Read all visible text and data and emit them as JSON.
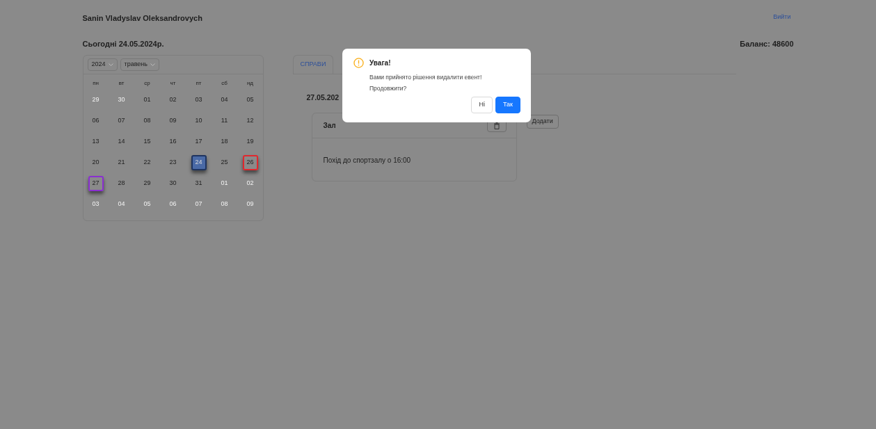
{
  "header": {
    "user_name": "Sanin Vladyslav Oleksandrovych",
    "logout": "Вийти",
    "today": "Сьогодні 24.05.2024р.",
    "balance": "Баланс: 48600"
  },
  "calendar": {
    "year": "2024",
    "month": "травень",
    "weekdays": [
      "пн",
      "вт",
      "ср",
      "чт",
      "пт",
      "сб",
      "нд"
    ],
    "weeks": [
      [
        {
          "label": "29",
          "outside": true,
          "selected": false,
          "today": false
        },
        {
          "label": "30",
          "outside": true,
          "selected": false,
          "today": false
        },
        {
          "label": "01",
          "outside": false,
          "selected": false,
          "today": false
        },
        {
          "label": "02",
          "outside": false,
          "selected": false,
          "today": false
        },
        {
          "label": "03",
          "outside": false,
          "selected": false,
          "today": false
        },
        {
          "label": "04",
          "outside": false,
          "selected": false,
          "today": false
        },
        {
          "label": "05",
          "outside": false,
          "selected": false,
          "today": false
        }
      ],
      [
        {
          "label": "06",
          "outside": false,
          "selected": false,
          "today": false
        },
        {
          "label": "07",
          "outside": false,
          "selected": false,
          "today": false
        },
        {
          "label": "08",
          "outside": false,
          "selected": false,
          "today": false
        },
        {
          "label": "09",
          "outside": false,
          "selected": false,
          "today": false
        },
        {
          "label": "10",
          "outside": false,
          "selected": false,
          "today": false
        },
        {
          "label": "11",
          "outside": false,
          "selected": false,
          "today": false
        },
        {
          "label": "12",
          "outside": false,
          "selected": false,
          "today": false
        }
      ],
      [
        {
          "label": "13",
          "outside": false,
          "selected": false,
          "today": false
        },
        {
          "label": "14",
          "outside": false,
          "selected": false,
          "today": false
        },
        {
          "label": "15",
          "outside": false,
          "selected": false,
          "today": false
        },
        {
          "label": "16",
          "outside": false,
          "selected": false,
          "today": false
        },
        {
          "label": "17",
          "outside": false,
          "selected": false,
          "today": false
        },
        {
          "label": "18",
          "outside": false,
          "selected": false,
          "today": false
        },
        {
          "label": "19",
          "outside": false,
          "selected": false,
          "today": false
        }
      ],
      [
        {
          "label": "20",
          "outside": false,
          "selected": false,
          "today": false
        },
        {
          "label": "21",
          "outside": false,
          "selected": false,
          "today": false
        },
        {
          "label": "22",
          "outside": false,
          "selected": false,
          "today": false
        },
        {
          "label": "23",
          "outside": false,
          "selected": false,
          "today": false
        },
        {
          "label": "24",
          "outside": false,
          "selected": false,
          "today": true
        },
        {
          "label": "25",
          "outside": false,
          "selected": false,
          "today": false
        },
        {
          "label": "26",
          "outside": false,
          "selected": false,
          "today": false,
          "color": "#e0282e"
        }
      ],
      [
        {
          "label": "27",
          "outside": false,
          "selected": true,
          "today": false
        },
        {
          "label": "28",
          "outside": false,
          "selected": false,
          "today": false
        },
        {
          "label": "29",
          "outside": false,
          "selected": false,
          "today": false
        },
        {
          "label": "30",
          "outside": false,
          "selected": false,
          "today": false
        },
        {
          "label": "31",
          "outside": false,
          "selected": false,
          "today": false
        },
        {
          "label": "01",
          "outside": true,
          "selected": false,
          "today": false
        },
        {
          "label": "02",
          "outside": true,
          "selected": false,
          "today": false
        }
      ],
      [
        {
          "label": "03",
          "outside": true,
          "selected": false,
          "today": false
        },
        {
          "label": "04",
          "outside": true,
          "selected": false,
          "today": false
        },
        {
          "label": "05",
          "outside": true,
          "selected": false,
          "today": false
        },
        {
          "label": "06",
          "outside": true,
          "selected": false,
          "today": false
        },
        {
          "label": "07",
          "outside": true,
          "selected": false,
          "today": false
        },
        {
          "label": "08",
          "outside": true,
          "selected": false,
          "today": false
        },
        {
          "label": "09",
          "outside": true,
          "selected": false,
          "today": false
        }
      ]
    ]
  },
  "tabs": [
    {
      "label": "СПРАВИ",
      "selected": true
    }
  ],
  "day_view": {
    "date": "27.05.202",
    "events": [
      {
        "title": "Зал",
        "text": "Похід до спортзалу о 16:00"
      }
    ],
    "add_button": "Додати"
  },
  "modal": {
    "title": "Увага!",
    "message_lines": [
      "Вами прийнято рішення видалити евент!",
      "Продовжити?"
    ],
    "buttons": [
      {
        "label": "Ні",
        "kind": "default"
      },
      {
        "label": "Так",
        "kind": "primary"
      }
    ]
  }
}
